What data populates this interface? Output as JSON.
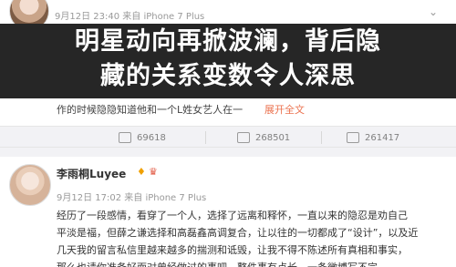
{
  "top_post": {
    "meta": "9月12日 23:40 来自 iPhone 7 Plus",
    "body_text": "作的时候隐隐知道他和一个L姓女艺人在一",
    "expand_label": "展开全文",
    "actions": [
      {
        "name": "repost",
        "count": "69618"
      },
      {
        "name": "comment",
        "count": "268501"
      },
      {
        "name": "like",
        "count": "261417"
      }
    ]
  },
  "banner": {
    "line1": "明星动向再掀波澜，背后隐",
    "line2": "藏的关系变数令人深思"
  },
  "second_post": {
    "username": "李雨桐Luyee",
    "meta": "9月12日 17:02 来自 iPhone 7 Plus",
    "lines": [
      "经历了一段感情，看穿了一个人，选择了远离和释怀，一直以来的隐忍是劝自己",
      "平淡是福，但薛之谦选择和高磊鑫高调复合，让以往的一切都成了“设计”，以及近",
      "几天我的留言私信里越来越多的揣测和诋毁，让我不得不陈述所有真相和事实，",
      "那么也请你准备好面对曾经做过的事吧，整件事有点长，一条微博写不完…"
    ]
  },
  "colors": {
    "banner_bg": "#262626",
    "link": "#eb7350",
    "bar_bg": "#f2f2f5"
  }
}
